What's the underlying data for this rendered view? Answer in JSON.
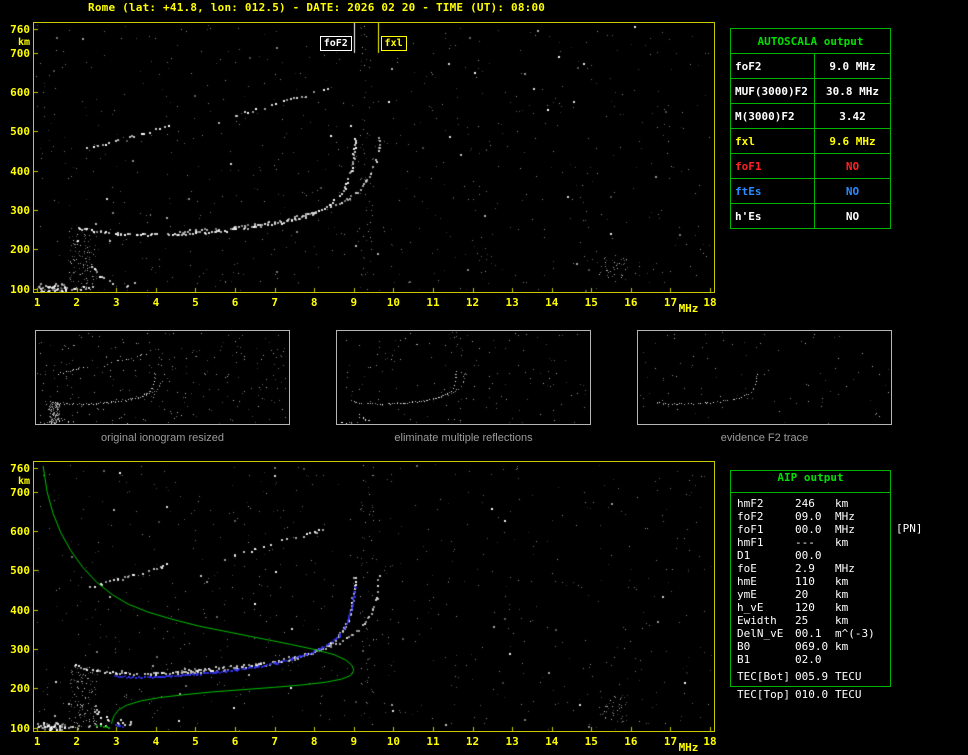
{
  "title": "Rome (lat: +41.8, lon: 012.5) - DATE: 2026 02 20 - TIME (UT): 08:00",
  "colors": {
    "axis_yellow": "#ffff00",
    "plot_border": "#c9c900",
    "table_green": "#00b400",
    "header_green": "#00e000",
    "alert_red": "#ff2222",
    "info_blue": "#2a8cff",
    "trace_white": "#ffffff",
    "fit_blue": "#3333ff",
    "profile_green": "#00c000"
  },
  "autoscala_table": {
    "header": "AUTOSCALA output",
    "rows": [
      {
        "label": "foF2",
        "value": "9.0 MHz",
        "color": "#ffffff"
      },
      {
        "label": "MUF(3000)F2",
        "value": "30.8 MHz",
        "color": "#ffffff"
      },
      {
        "label": "M(3000)F2",
        "value": "3.42",
        "color": "#ffffff"
      },
      {
        "label": "fxl",
        "value": "9.6 MHz",
        "color": "#ffff00"
      },
      {
        "label": "foF1",
        "value": "NO",
        "color": "#ff2222"
      },
      {
        "label": "ftEs",
        "value": "NO",
        "color": "#2a8cff"
      },
      {
        "label": "h'Es",
        "value": "NO",
        "color": "#ffffff"
      }
    ]
  },
  "aip_table": {
    "header": "AIP output",
    "pn_note": "[PN]",
    "rows": [
      {
        "name": "hmF2",
        "value": "246",
        "unit": "km"
      },
      {
        "name": "foF2",
        "value": "09.0",
        "unit": "MHz"
      },
      {
        "name": "foF1",
        "value": "00.0",
        "unit": "MHz"
      },
      {
        "name": "hmF1",
        "value": "---",
        "unit": "km"
      },
      {
        "name": "D1",
        "value": "00.0",
        "unit": ""
      },
      {
        "name": "foE",
        "value": "2.9",
        "unit": "MHz"
      },
      {
        "name": "hmE",
        "value": "110",
        "unit": "km"
      },
      {
        "name": "ymE",
        "value": "20",
        "unit": "km"
      },
      {
        "name": "h_vE",
        "value": "120",
        "unit": "km"
      },
      {
        "name": "Ewidth",
        "value": "25",
        "unit": "km"
      },
      {
        "name": "DelN_vE",
        "value": "00.1",
        "unit": "m^(-3)"
      },
      {
        "name": "B0",
        "value": "069.0",
        "unit": "km"
      },
      {
        "name": "B1",
        "value": "02.0",
        "unit": ""
      },
      {
        "name": "TEC[Bot]",
        "value": "005.9",
        "unit": "TECU",
        "section": "tec"
      },
      {
        "name": "TEC[Top]",
        "value": "010.0",
        "unit": "TECU",
        "outside": true
      }
    ]
  },
  "thumbnails": [
    {
      "caption": "original ionogram resized"
    },
    {
      "caption": "eliminate multiple reflections"
    },
    {
      "caption": "evidence F2 trace"
    }
  ],
  "chart_data": [
    {
      "id": "ionogram_top",
      "type": "scatter",
      "title": "recorded ionogram with scaled foF2 / fxl markers",
      "xlabel": "MHz",
      "ylabel": "km",
      "xlim": [
        0.92,
        18.1
      ],
      "ylim": [
        92,
        775
      ],
      "xticks": [
        1,
        2,
        3,
        4,
        5,
        6,
        7,
        8,
        9,
        10,
        11,
        12,
        13,
        14,
        15,
        16,
        17,
        18
      ],
      "yticks": [
        760,
        700,
        600,
        500,
        400,
        300,
        200,
        100
      ],
      "axis_labels": true,
      "seed": 7,
      "markers": [
        {
          "f": 9.0,
          "label": "foF2",
          "color": "#ffffff"
        },
        {
          "f": 9.6,
          "label": "fxl",
          "color": "#ffff00"
        }
      ],
      "traces": [
        {
          "name": "f2-ordinary",
          "color": "#ffffff",
          "mode": "dots",
          "size": 2,
          "step": 2.5,
          "jitter": 1.3,
          "drop": 0.18,
          "points": [
            [
              1.9,
              262
            ],
            [
              2.2,
              252
            ],
            [
              2.6,
              246
            ],
            [
              3.0,
              242
            ],
            [
              3.5,
              240
            ],
            [
              4.0,
              239
            ],
            [
              4.5,
              241
            ],
            [
              5.0,
              244
            ],
            [
              5.5,
              248
            ],
            [
              6.0,
              253
            ],
            [
              6.5,
              259
            ],
            [
              7.0,
              267
            ],
            [
              7.4,
              276
            ],
            [
              7.8,
              288
            ],
            [
              8.1,
              301
            ],
            [
              8.4,
              317
            ],
            [
              8.6,
              335
            ],
            [
              8.75,
              356
            ],
            [
              8.85,
              380
            ],
            [
              8.92,
              405
            ],
            [
              8.97,
              432
            ],
            [
              9.0,
              460
            ],
            [
              9.02,
              485
            ]
          ]
        },
        {
          "name": "f2-extraordinary",
          "color": "#dddddd",
          "mode": "dots",
          "size": 2,
          "step": 3,
          "jitter": 1.2,
          "drop": 0.3,
          "points": [
            [
              4.5,
              247
            ],
            [
              5.0,
              250
            ],
            [
              5.5,
              253
            ],
            [
              6.0,
              258
            ],
            [
              6.5,
              264
            ],
            [
              7.0,
              272
            ],
            [
              7.5,
              282
            ],
            [
              8.0,
              295
            ],
            [
              8.4,
              310
            ],
            [
              8.8,
              329
            ],
            [
              9.1,
              350
            ],
            [
              9.3,
              374
            ],
            [
              9.45,
              402
            ],
            [
              9.55,
              432
            ],
            [
              9.6,
              462
            ],
            [
              9.62,
              487
            ]
          ]
        },
        {
          "name": "second-hop-a",
          "color": "#ffffff",
          "mode": "dots",
          "size": 2,
          "step": 4,
          "jitter": 1.5,
          "drop": 0.35,
          "points": [
            [
              2.2,
              458
            ],
            [
              2.6,
              468
            ],
            [
              3.0,
              478
            ],
            [
              3.4,
              489
            ],
            [
              3.8,
              500
            ],
            [
              4.1,
              509
            ],
            [
              4.35,
              517
            ]
          ]
        },
        {
          "name": "second-hop-b",
          "color": "#ffffff",
          "mode": "dots",
          "size": 2,
          "step": 4,
          "jitter": 1.5,
          "drop": 0.35,
          "points": [
            [
              5.5,
              522
            ],
            [
              6.0,
              541
            ],
            [
              6.5,
              557
            ],
            [
              7.0,
              572
            ],
            [
              7.5,
              586
            ],
            [
              8.0,
              599
            ],
            [
              8.4,
              611
            ]
          ]
        },
        {
          "name": "es-trace",
          "color": "#ffffff",
          "mode": "dots",
          "size": 2,
          "step": 3,
          "jitter": 1.5,
          "drop": 0.3,
          "points": [
            [
              1.15,
              107
            ],
            [
              1.5,
              104
            ],
            [
              1.9,
              103
            ],
            [
              2.3,
              105
            ],
            [
              2.7,
              110
            ]
          ]
        },
        {
          "name": "e-cusp",
          "color": "#ffffff",
          "mode": "dots",
          "size": 2,
          "step": 3,
          "jitter": 3,
          "drop": 0.3,
          "points": [
            [
              2.35,
              155
            ],
            [
              2.5,
              143
            ],
            [
              2.65,
              132
            ],
            [
              2.8,
              124
            ],
            [
              3.0,
              118
            ],
            [
              3.2,
              114
            ],
            [
              3.4,
              112
            ]
          ]
        },
        {
          "name": "clutter-low",
          "mode": "noise",
          "color": "#cccccc",
          "count": 130,
          "size": 1,
          "x": [
            1.8,
            2.5
          ],
          "y": [
            100,
            255
          ]
        },
        {
          "name": "clutter-origin",
          "mode": "noise",
          "color": "#ffffff",
          "count": 40,
          "size": 2,
          "x": [
            1.0,
            1.7
          ],
          "y": [
            95,
            115
          ]
        },
        {
          "name": "band-9",
          "mode": "noise",
          "color": "#aaaaaa",
          "count": 70,
          "size": 1,
          "x": [
            9.15,
            9.5
          ],
          "y": [
            95,
            770
          ]
        },
        {
          "name": "cluster-15",
          "mode": "noise",
          "color": "#cccccc",
          "count": 45,
          "size": 1,
          "x": [
            15.2,
            15.9
          ],
          "y": [
            115,
            185
          ]
        },
        {
          "name": "blobs",
          "mode": "noise",
          "color": "#ffffff",
          "count": 55,
          "size": 2,
          "x": [
            1.0,
            18.0
          ],
          "y": [
            95,
            770
          ]
        },
        {
          "name": "ambient",
          "mode": "noise",
          "color": "#9a9a9a",
          "count": 650,
          "size": 1,
          "x": [
            0.95,
            18.05
          ],
          "y": [
            95,
            772
          ]
        }
      ]
    },
    {
      "id": "thumb_original",
      "type": "scatter",
      "title": "original ionogram resized",
      "xlim": [
        0.92,
        18.1
      ],
      "ylim": [
        92,
        775
      ],
      "axis_labels": false,
      "seed": 21,
      "dot_scale": 0.5,
      "ref": "ionogram_top",
      "include": [
        "f2-ordinary",
        "f2-extraordinary",
        "second-hop-a",
        "second-hop-b",
        "es-trace",
        "e-cusp",
        "clutter-low"
      ],
      "traces": [
        {
          "name": "ambient-thumb",
          "mode": "noise",
          "color": "#bbbbbb",
          "count": 260,
          "size": 1,
          "x": [
            0.95,
            18.0
          ],
          "y": [
            95,
            770
          ]
        }
      ]
    },
    {
      "id": "thumb_clean",
      "type": "scatter",
      "title": "eliminate multiple reflections",
      "xlim": [
        0.92,
        18.1
      ],
      "ylim": [
        92,
        775
      ],
      "axis_labels": false,
      "seed": 22,
      "dot_scale": 0.5,
      "ref": "ionogram_top",
      "include": [
        "f2-ordinary",
        "f2-extraordinary",
        "es-trace",
        "e-cusp"
      ],
      "traces": [
        {
          "name": "ambient-thumb",
          "mode": "noise",
          "color": "#bbbbbb",
          "count": 150,
          "size": 1,
          "x": [
            0.95,
            18.0
          ],
          "y": [
            95,
            770
          ]
        }
      ]
    },
    {
      "id": "thumb_f2",
      "type": "scatter",
      "title": "evidence F2 trace",
      "xlim": [
        0.92,
        18.1
      ],
      "ylim": [
        92,
        775
      ],
      "axis_labels": false,
      "seed": 23,
      "dot_scale": 0.5,
      "ref": "ionogram_top",
      "include": [
        "f2-ordinary"
      ],
      "traces": [
        {
          "name": "ambient-thumb",
          "mode": "noise",
          "color": "#bbbbbb",
          "count": 90,
          "size": 1,
          "x": [
            0.95,
            18.0
          ],
          "y": [
            95,
            770
          ]
        }
      ]
    },
    {
      "id": "ionogram_bottom",
      "type": "scatter",
      "title": "ionogram with AUTOSCALA fitted trace (blue) and AIP electron density profile (green)",
      "xlabel": "MHz",
      "ylabel": "km",
      "xlim": [
        0.92,
        18.1
      ],
      "ylim": [
        92,
        775
      ],
      "xticks": [
        1,
        2,
        3,
        4,
        5,
        6,
        7,
        8,
        9,
        10,
        11,
        12,
        13,
        14,
        15,
        16,
        17,
        18
      ],
      "yticks": [
        760,
        700,
        600,
        500,
        400,
        300,
        200,
        100
      ],
      "axis_labels": true,
      "seed": 31,
      "ref": "ionogram_top",
      "include": [
        "f2-ordinary",
        "f2-extraordinary",
        "second-hop-a",
        "second-hop-b",
        "es-trace",
        "e-cusp",
        "clutter-low",
        "clutter-origin",
        "band-9",
        "cluster-15",
        "blobs",
        "ambient"
      ],
      "traces": [
        {
          "name": "fit-trace",
          "color": "#3333ff",
          "mode": "dots",
          "size": 2,
          "step": 2,
          "jitter": 0.7,
          "drop": 0.05,
          "points": [
            [
              2.95,
              234
            ],
            [
              3.3,
              231
            ],
            [
              3.7,
              230
            ],
            [
              4.1,
              231
            ],
            [
              4.5,
              234
            ],
            [
              5.0,
              238
            ],
            [
              5.5,
              243
            ],
            [
              6.0,
              249
            ],
            [
              6.5,
              257
            ],
            [
              7.0,
              266
            ],
            [
              7.4,
              276
            ],
            [
              7.8,
              289
            ],
            [
              8.1,
              302
            ],
            [
              8.4,
              318
            ],
            [
              8.6,
              336
            ],
            [
              8.75,
              357
            ],
            [
              8.85,
              381
            ],
            [
              8.93,
              407
            ],
            [
              8.98,
              434
            ],
            [
              9.01,
              461
            ]
          ]
        },
        {
          "name": "density-profile",
          "color": "#00c000",
          "mode": "line",
          "width": 1,
          "points": [
            [
              1.15,
              765
            ],
            [
              1.25,
              700
            ],
            [
              1.4,
              645
            ],
            [
              1.6,
              595
            ],
            [
              1.85,
              550
            ],
            [
              2.15,
              508
            ],
            [
              2.5,
              470
            ],
            [
              2.9,
              438
            ],
            [
              3.3,
              414
            ],
            [
              3.8,
              394
            ],
            [
              4.4,
              376
            ],
            [
              5.1,
              358
            ],
            [
              5.9,
              342
            ],
            [
              6.7,
              326
            ],
            [
              7.4,
              312
            ],
            [
              8.0,
              299
            ],
            [
              8.5,
              286
            ],
            [
              8.8,
              272
            ],
            [
              8.95,
              259
            ],
            [
              9.0,
              246
            ],
            [
              8.92,
              233
            ],
            [
              8.7,
              224
            ],
            [
              8.3,
              216
            ],
            [
              7.7,
              209
            ],
            [
              7.0,
              203
            ],
            [
              6.2,
              197
            ],
            [
              5.4,
              191
            ],
            [
              4.7,
              184
            ],
            [
              4.1,
              177
            ],
            [
              3.6,
              168
            ],
            [
              3.25,
              157
            ],
            [
              3.05,
              145
            ],
            [
              2.95,
              132
            ],
            [
              2.9,
              120
            ],
            [
              2.88,
              110
            ]
          ]
        },
        {
          "name": "es-marks-green",
          "color": "#00c000",
          "mode": "dots",
          "size": 2,
          "step": 3,
          "jitter": 1,
          "drop": 0.2,
          "points": [
            [
              2.5,
              106
            ],
            [
              2.8,
              104
            ]
          ]
        },
        {
          "name": "es-marks-blue",
          "color": "#3333ff",
          "mode": "dots",
          "size": 2,
          "step": 3,
          "jitter": 1,
          "drop": 0.2,
          "points": [
            [
              2.95,
              108
            ],
            [
              3.15,
              105
            ]
          ]
        }
      ]
    }
  ]
}
